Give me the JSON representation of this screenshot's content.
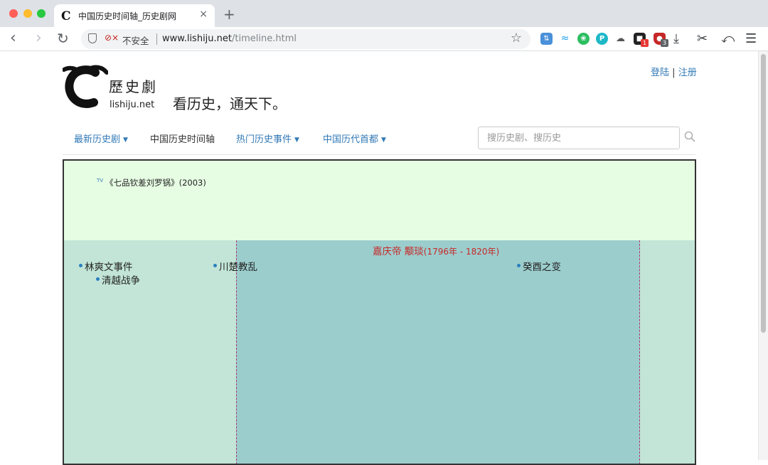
{
  "browser": {
    "tab_title": "中国历史时间轴_历史剧网",
    "tab_icon": "C",
    "close_glyph": "×",
    "new_tab_glyph": "+",
    "security_label": "不安全",
    "url_host": "www.lishiju.net",
    "url_path": "/timeline.html",
    "extension_badges": [
      "1",
      "3"
    ]
  },
  "site": {
    "logo_glyphs": "歷史劇",
    "logo_domain": "lishiju.net",
    "slogan": "看历史，通天下。",
    "auth": {
      "login": "登陆",
      "separator": "|",
      "register": "注册"
    }
  },
  "nav": {
    "items": [
      {
        "label": "最新历史剧",
        "dropdown": true
      },
      {
        "label": "中国历史时间轴",
        "dropdown": false
      },
      {
        "label": "热门历史事件",
        "dropdown": true
      },
      {
        "label": "中国历代首都",
        "dropdown": true
      }
    ],
    "caret": "▼",
    "search_placeholder": "搜历史剧、搜历史"
  },
  "timeline": {
    "tv_marker": "TV",
    "tv_item": "《七品钦差刘罗锅》(2003)",
    "reign_name": "嘉庆帝 颙琰",
    "reign_years": "(1796年 - 1820年)",
    "events": [
      "林爽文事件",
      "清越战争",
      "川楚教乱",
      "癸酉之变"
    ]
  },
  "colors": {
    "link": "#337ab7",
    "reign_text": "#c62828",
    "tv_band": "#e6fde3",
    "timeline_bg": "#c2e5d8",
    "reign_bg": "#9ccdcd"
  }
}
